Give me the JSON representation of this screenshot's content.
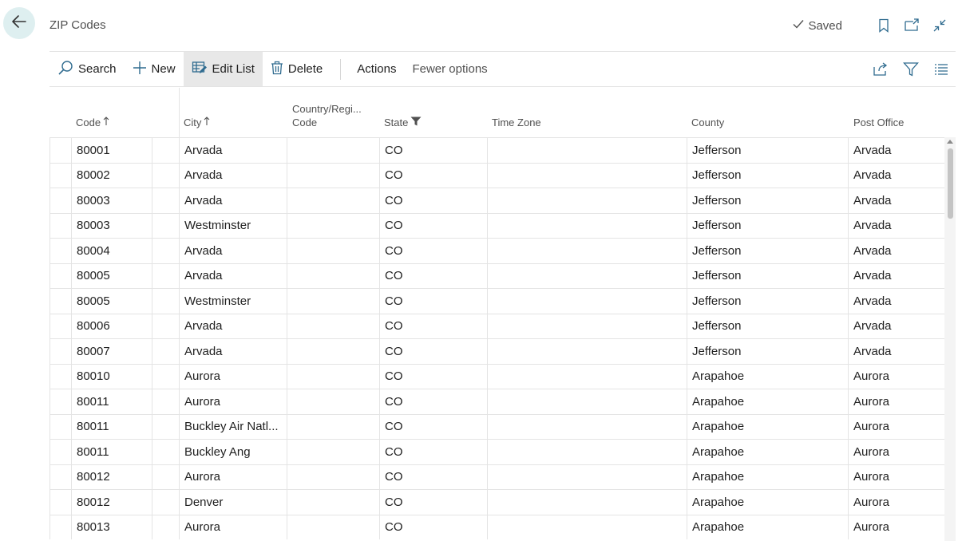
{
  "header": {
    "title": "ZIP Codes",
    "saved_label": "Saved"
  },
  "toolbar": {
    "search": "Search",
    "new": "New",
    "edit_list": "Edit List",
    "delete": "Delete",
    "actions": "Actions",
    "fewer_options": "Fewer options"
  },
  "columns": {
    "code": "Code",
    "city": "City",
    "country_line1": "Country/Regi...",
    "country_line2": "Code",
    "state": "State",
    "time_zone": "Time Zone",
    "county": "County",
    "post_office": "Post Office"
  },
  "rows": [
    {
      "code": "80001",
      "city": "Arvada",
      "country": "",
      "state": "CO",
      "time_zone": "",
      "county": "Jefferson",
      "post_office": "Arvada"
    },
    {
      "code": "80002",
      "city": "Arvada",
      "country": "",
      "state": "CO",
      "time_zone": "",
      "county": "Jefferson",
      "post_office": "Arvada"
    },
    {
      "code": "80003",
      "city": "Arvada",
      "country": "",
      "state": "CO",
      "time_zone": "",
      "county": "Jefferson",
      "post_office": "Arvada"
    },
    {
      "code": "80003",
      "city": "Westminster",
      "country": "",
      "state": "CO",
      "time_zone": "",
      "county": "Jefferson",
      "post_office": "Arvada"
    },
    {
      "code": "80004",
      "city": "Arvada",
      "country": "",
      "state": "CO",
      "time_zone": "",
      "county": "Jefferson",
      "post_office": "Arvada"
    },
    {
      "code": "80005",
      "city": "Arvada",
      "country": "",
      "state": "CO",
      "time_zone": "",
      "county": "Jefferson",
      "post_office": "Arvada"
    },
    {
      "code": "80005",
      "city": "Westminster",
      "country": "",
      "state": "CO",
      "time_zone": "",
      "county": "Jefferson",
      "post_office": "Arvada"
    },
    {
      "code": "80006",
      "city": "Arvada",
      "country": "",
      "state": "CO",
      "time_zone": "",
      "county": "Jefferson",
      "post_office": "Arvada"
    },
    {
      "code": "80007",
      "city": "Arvada",
      "country": "",
      "state": "CO",
      "time_zone": "",
      "county": "Jefferson",
      "post_office": "Arvada"
    },
    {
      "code": "80010",
      "city": "Aurora",
      "country": "",
      "state": "CO",
      "time_zone": "",
      "county": "Arapahoe",
      "post_office": "Aurora"
    },
    {
      "code": "80011",
      "city": "Aurora",
      "country": "",
      "state": "CO",
      "time_zone": "",
      "county": "Arapahoe",
      "post_office": "Aurora"
    },
    {
      "code": "80011",
      "city": "Buckley Air Natl...",
      "country": "",
      "state": "CO",
      "time_zone": "",
      "county": "Arapahoe",
      "post_office": "Aurora"
    },
    {
      "code": "80011",
      "city": "Buckley Ang",
      "country": "",
      "state": "CO",
      "time_zone": "",
      "county": "Arapahoe",
      "post_office": "Aurora"
    },
    {
      "code": "80012",
      "city": "Aurora",
      "country": "",
      "state": "CO",
      "time_zone": "",
      "county": "Arapahoe",
      "post_office": "Aurora"
    },
    {
      "code": "80012",
      "city": "Denver",
      "country": "",
      "state": "CO",
      "time_zone": "",
      "county": "Arapahoe",
      "post_office": "Aurora"
    },
    {
      "code": "80013",
      "city": "Aurora",
      "country": "",
      "state": "CO",
      "time_zone": "",
      "county": "Arapahoe",
      "post_office": "Aurora"
    }
  ],
  "icons": {
    "back": "arrow-left-icon",
    "saved": "checkmark-icon",
    "bookmark": "bookmark-icon",
    "open_new": "open-in-new-window-icon",
    "collapse": "collapse-icon",
    "search": "search-icon",
    "new": "plus-icon",
    "edit_list": "edit-list-icon",
    "delete": "trash-icon",
    "share": "share-icon",
    "filter": "filter-icon",
    "list": "list-view-icon"
  },
  "colors": {
    "accent": "#deeff0",
    "active_button": "#e8e8e8",
    "border": "#e4e4e4"
  }
}
